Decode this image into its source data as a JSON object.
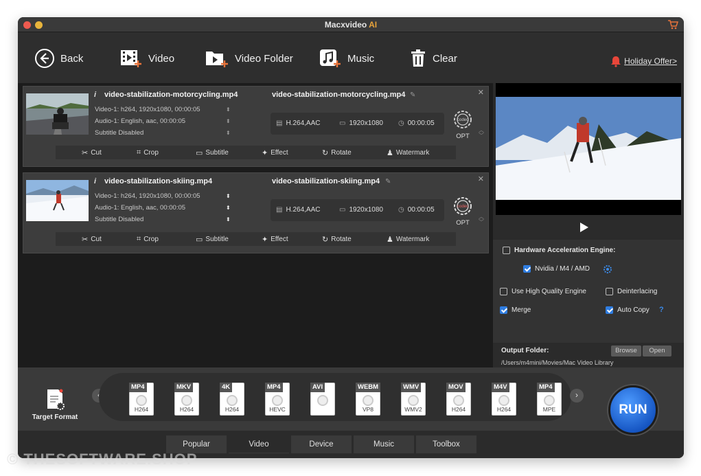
{
  "app": {
    "title_main": "Macxvideo",
    "title_ai": "AI"
  },
  "colors": {
    "accent": "#2f7de1",
    "ai_orange": "#e8a33a",
    "close_red": "#ee5a4f",
    "min_yellow": "#e8b43c"
  },
  "toolbar": {
    "back": "Back",
    "video": "Video",
    "video_folder": "Video Folder",
    "music": "Music",
    "clear": "Clear",
    "offer": "Holiday Offer>"
  },
  "items": [
    {
      "source_name": "video-stabilization-motorcycling.mp4",
      "video_track": "Video-1: h264, 1920x1080, 00:00:05",
      "audio_track": "Audio-1: English, aac, 00:00:05",
      "subtitle": "Subtitle Disabled",
      "output_name": "video-stabilization-motorcycling.mp4",
      "codec": "H.264,AAC",
      "resolution": "1920x1080",
      "duration": "00:00:05",
      "opt": "OPT"
    },
    {
      "source_name": "video-stabilization-skiing.mp4",
      "video_track": "Video-1: h264, 1920x1080, 00:00:05",
      "audio_track": "Audio-1: English, aac, 00:00:05",
      "subtitle": "Subtitle Disabled",
      "output_name": "video-stabilization-skiing.mp4",
      "codec": "H.264,AAC",
      "resolution": "1920x1080",
      "duration": "00:00:05",
      "opt": "OPT"
    }
  ],
  "edit": {
    "cut": "Cut",
    "crop": "Crop",
    "subtitle": "Subtitle",
    "effect": "Effect",
    "rotate": "Rotate",
    "watermark": "Watermark"
  },
  "settings": {
    "hw_accel": "Hardware Acceleration Engine:",
    "hw_accel_checked": false,
    "gpu": "Nvidia / M4 / AMD",
    "gpu_checked": true,
    "hq_engine": "Use High Quality Engine",
    "hq_engine_checked": false,
    "deinterlacing": "Deinterlacing",
    "deinterlacing_checked": false,
    "merge": "Merge",
    "merge_checked": true,
    "auto_copy": "Auto Copy",
    "auto_copy_checked": true,
    "help": "?"
  },
  "output": {
    "label": "Output Folder:",
    "path": "/Users/m4mini/Movies/Mac Video Library",
    "browse": "Browse",
    "open": "Open"
  },
  "target_format": {
    "label": "Target Format"
  },
  "formats": [
    {
      "name": "MP4",
      "codec": "H264"
    },
    {
      "name": "MKV",
      "codec": "H264"
    },
    {
      "name": "4K",
      "codec": "H264"
    },
    {
      "name": "MP4",
      "codec": "HEVC"
    },
    {
      "name": "AVI",
      "codec": ""
    },
    {
      "name": "WEBM",
      "codec": "VP8"
    },
    {
      "name": "WMV",
      "codec": "WMV2"
    },
    {
      "name": "MOV",
      "codec": "H264"
    },
    {
      "name": "M4V",
      "codec": "H264"
    },
    {
      "name": "MP4",
      "codec": "MPE"
    }
  ],
  "tabs": [
    "Popular",
    "Video",
    "Device",
    "Music",
    "Toolbox"
  ],
  "active_tab": "Video",
  "run": "RUN",
  "watermark": "© THESOFTWARE.SHOP"
}
